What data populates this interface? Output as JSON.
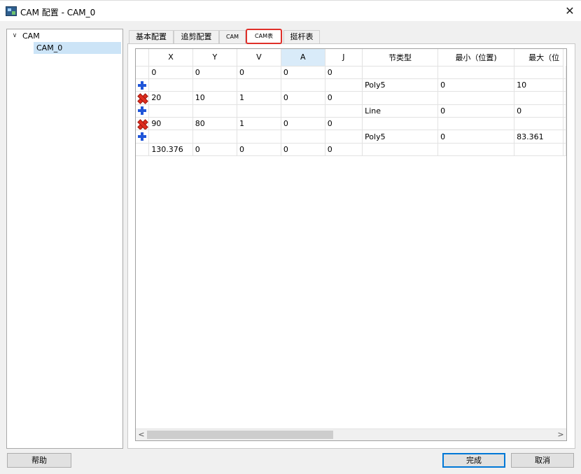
{
  "window": {
    "title": "CAM 配置 - CAM_0",
    "close_glyph": "✕"
  },
  "tree": {
    "root_label": "CAM",
    "chevron_glyph": "∨",
    "child_label": "CAM_0"
  },
  "tabs": [
    {
      "label": "基本配置"
    },
    {
      "label": "追剪配置"
    },
    {
      "label": "CAM"
    },
    {
      "label": "CAM表",
      "active": true
    },
    {
      "label": "挺杆表"
    }
  ],
  "grid": {
    "columns": [
      "X",
      "Y",
      "V",
      "A",
      "J",
      "节类型",
      "最小（位置)",
      "最大（位"
    ],
    "selected_column": "A",
    "rows": [
      {
        "marker": "",
        "cells": [
          "0",
          "0",
          "0",
          "0",
          "0",
          "",
          "",
          ""
        ]
      },
      {
        "marker": "plus",
        "cells": [
          "",
          "",
          "",
          "",
          "",
          "Poly5",
          "0",
          "10"
        ]
      },
      {
        "marker": "cross",
        "cells": [
          "20",
          "10",
          "1",
          "0",
          "0",
          "",
          "",
          ""
        ]
      },
      {
        "marker": "plus",
        "cells": [
          "",
          "",
          "",
          "",
          "",
          "Line",
          "0",
          "0"
        ]
      },
      {
        "marker": "cross",
        "cells": [
          "90",
          "80",
          "1",
          "0",
          "0",
          "",
          "",
          ""
        ]
      },
      {
        "marker": "plus",
        "cells": [
          "",
          "",
          "",
          "",
          "",
          "Poly5",
          "0",
          "83.361"
        ]
      },
      {
        "marker": "",
        "cells": [
          "130.376",
          "0",
          "0",
          "0",
          "0",
          "",
          "",
          ""
        ]
      }
    ],
    "scroll_left_glyph": "<",
    "scroll_right_glyph": ">"
  },
  "buttons": {
    "help": "帮助",
    "finish": "完成",
    "cancel": "取消"
  },
  "colors": {
    "tab_highlight": "#e0302a",
    "add_icon": "#1f55d8",
    "delete_icon": "#e02c1e",
    "selection": "#cce4f7"
  }
}
